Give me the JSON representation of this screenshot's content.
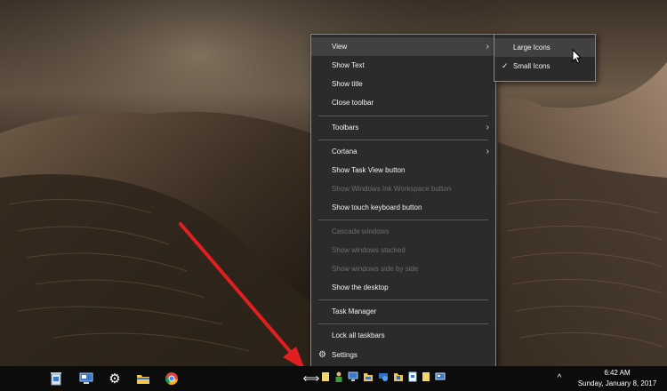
{
  "context_menu": {
    "items": [
      {
        "label": "View",
        "has_submenu": true,
        "highlighted": true
      },
      {
        "label": "Show Text"
      },
      {
        "label": "Show title"
      },
      {
        "label": "Close toolbar"
      },
      {
        "label": "Toolbars",
        "has_submenu": true
      },
      {
        "label": "Cortana",
        "has_submenu": true
      },
      {
        "label": "Show Task View button"
      },
      {
        "label": "Show Windows Ink Workspace button",
        "disabled": true
      },
      {
        "label": "Show touch keyboard button"
      },
      {
        "label": "Cascade windows",
        "disabled": true
      },
      {
        "label": "Show windows stacked",
        "disabled": true
      },
      {
        "label": "Show windows side by side",
        "disabled": true
      },
      {
        "label": "Show the desktop"
      },
      {
        "label": "Task Manager"
      },
      {
        "label": "Lock all taskbars"
      },
      {
        "label": "Settings",
        "icon": "gear-icon"
      }
    ]
  },
  "view_submenu": {
    "items": [
      {
        "label": "Large Icons",
        "highlighted": true
      },
      {
        "label": "Small Icons",
        "checked": true
      }
    ]
  },
  "taskbar": {
    "pinned_apps": [
      "recycle-bin-icon",
      "network-computer-icon",
      "settings-gear-icon",
      "file-explorer-icon",
      "chrome-icon"
    ],
    "toolbar_icons": [
      "folder-icon",
      "user-icon",
      "monitor-icon",
      "folder-open-icon",
      "network-icon",
      "folder-icon",
      "printer-icon",
      "folder-icon",
      "computer-icon"
    ],
    "tray_chevron": "^",
    "clock": {
      "time": "6:42 AM",
      "date": "Sunday, January 8, 2017"
    }
  },
  "colors": {
    "menu_bg": "#2b2b2b",
    "menu_highlight": "#414141",
    "taskbar_bg": "#0c0c0c",
    "annotation_arrow": "#e02020"
  }
}
